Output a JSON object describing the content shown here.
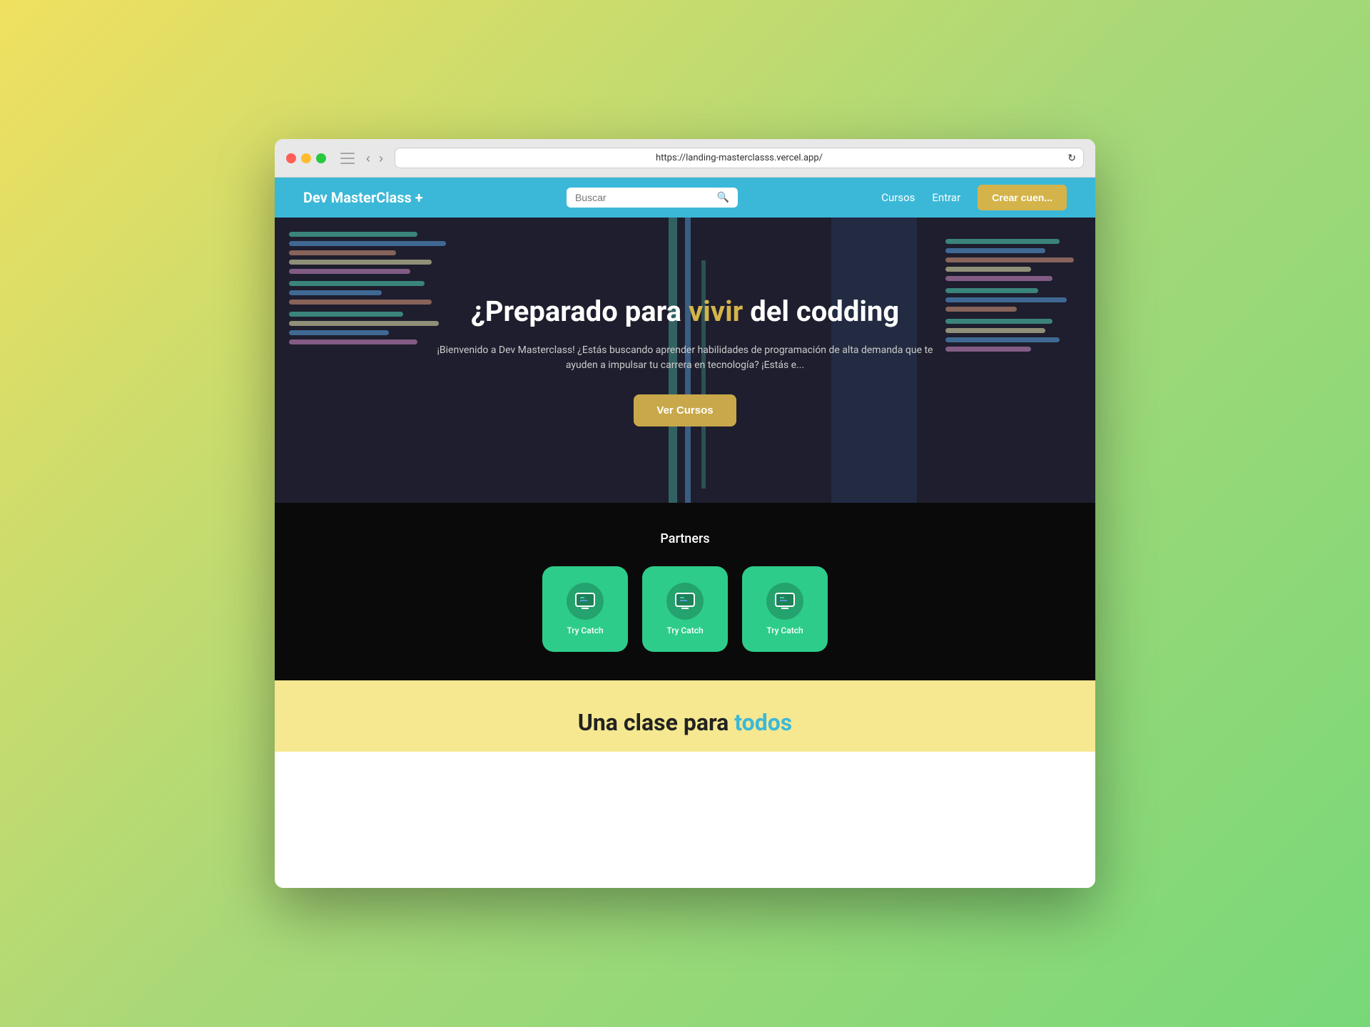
{
  "browser": {
    "url": "https://landing-masterclasss.vercel.app/",
    "back_btn": "‹",
    "forward_btn": "›"
  },
  "navbar": {
    "logo": "Dev MasterClass +",
    "search_placeholder": "Buscar",
    "nav_links": [
      {
        "label": "Cursos"
      },
      {
        "label": "Entrar"
      }
    ],
    "cta_label": "Crear cuen..."
  },
  "hero": {
    "title_part1": "¿Preparado para ",
    "title_highlight": "vivir",
    "title_part2": " del codding",
    "subtitle": "¡Bienvenido a Dev Masterclass! ¿Estás buscando aprender habilidades de programación de alta demanda que te ayuden a impulsar tu carrera en tecnología? ¡Estás e...",
    "cta_label": "Ver Cursos"
  },
  "partners": {
    "title": "Partners",
    "cards": [
      {
        "label": "Try  Catch",
        "icon": "💻"
      },
      {
        "label": "Try  Catch",
        "icon": "💻"
      },
      {
        "label": "Try  Catch",
        "icon": "💻"
      }
    ]
  },
  "bottom": {
    "title_part1": "Una clase para ",
    "title_highlight": "todos"
  }
}
